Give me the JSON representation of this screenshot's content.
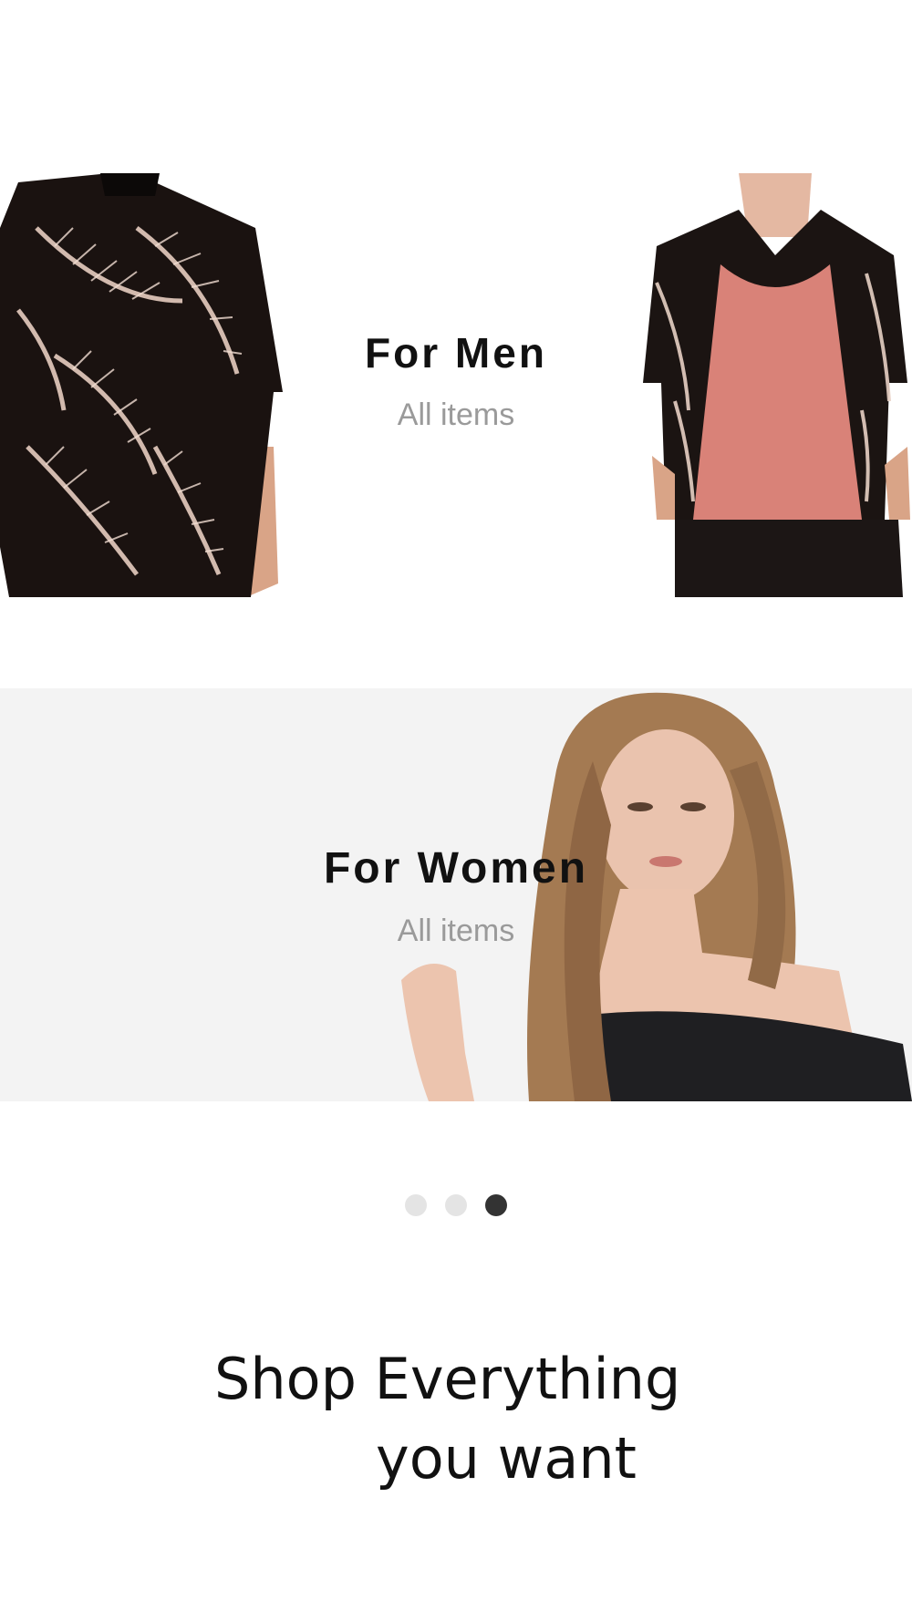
{
  "categories": [
    {
      "title": "For Men",
      "subtitle": "All items"
    },
    {
      "title": "For Women",
      "subtitle": "All items"
    }
  ],
  "pager": {
    "count": 3,
    "active_index": 2
  },
  "tagline": {
    "line1": "Shop Everything",
    "line2": "you want"
  },
  "colors": {
    "background": "#ffffff",
    "title": "#111111",
    "subtitle": "#9a9a9a",
    "dot_inactive": "#e4e4e4",
    "dot_active": "#333333",
    "women_card_bg": "#f3f3f3"
  }
}
